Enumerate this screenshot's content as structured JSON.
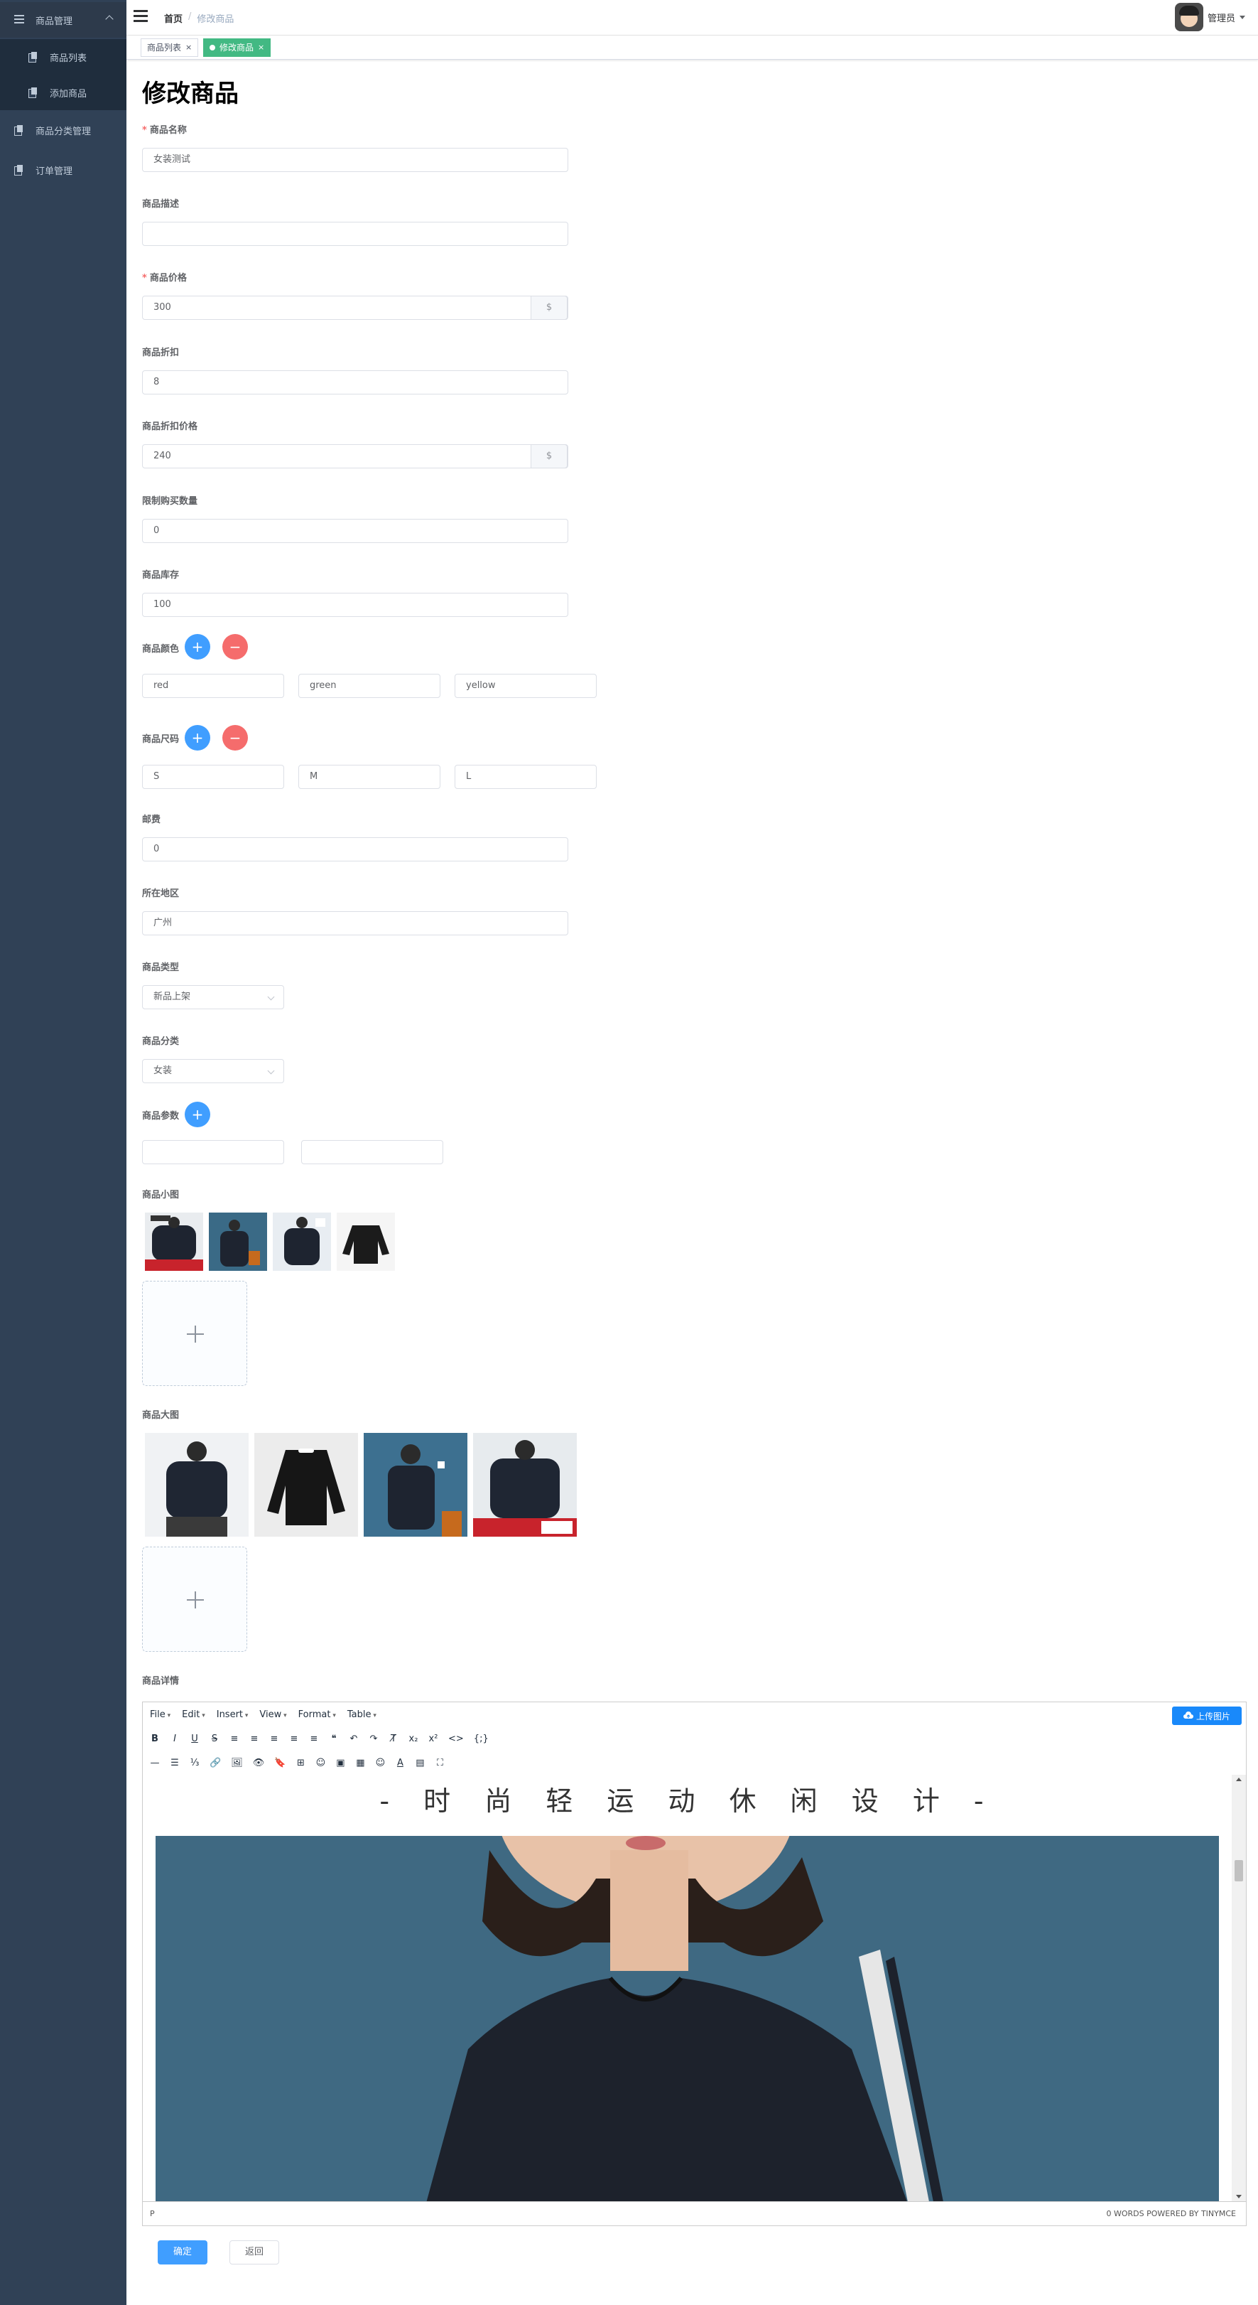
{
  "sidebar": {
    "menu_product_mgmt": "商品管理",
    "menu_product_list": "商品列表",
    "menu_add_product": "添加商品",
    "menu_category_mgmt": "商品分类管理",
    "menu_order_mgmt": "订单管理"
  },
  "navbar": {
    "breadcrumb_home": "首页",
    "breadcrumb_sep": "/",
    "breadcrumb_current": "修改商品",
    "username": "管理员"
  },
  "tags": {
    "list": "商品列表",
    "edit": "修改商品",
    "close": "×"
  },
  "page": {
    "title": "修改商品"
  },
  "form": {
    "name_label": "商品名称",
    "name_value": "女装测试",
    "desc_label": "商品描述",
    "desc_value": "",
    "price_label": "商品价格",
    "price_value": "300",
    "currency": "$",
    "discount_label": "商品折扣",
    "discount_value": "8",
    "discount_price_label": "商品折扣价格",
    "discount_price_value": "240",
    "limit_label": "限制购买数量",
    "limit_value": "0",
    "stock_label": "商品库存",
    "stock_value": "100",
    "color_label": "商品颜色",
    "colors": [
      "red",
      "green",
      "yellow"
    ],
    "size_label": "商品尺码",
    "sizes": [
      "S",
      "M",
      "L"
    ],
    "shipping_label": "邮费",
    "shipping_value": "0",
    "region_label": "所在地区",
    "region_value": "广州",
    "type_label": "商品类型",
    "type_value": "新品上架",
    "category_label": "商品分类",
    "category_value": "女装",
    "params_label": "商品参数",
    "small_images_label": "商品小图",
    "large_images_label": "商品大图",
    "detail_label": "商品详情",
    "add_symbol": "+",
    "remove_symbol": "−"
  },
  "editor": {
    "menus": [
      "File",
      "Edit",
      "Insert",
      "View",
      "Format",
      "Table"
    ],
    "upload_button": "上传图片",
    "toolbar_row1": [
      "B",
      "I",
      "U",
      "S",
      "≡",
      "≡",
      "≡",
      "≡",
      "≡",
      "❝",
      "↶",
      "↷",
      "T̸",
      "x₂",
      "x²",
      "<>",
      "{;}"
    ],
    "toolbar_row2": [
      "—",
      "☰",
      "⅓",
      "🔗",
      "🖼",
      "👁",
      "🔖",
      "⊞",
      "☺",
      "▣",
      "▦",
      "☺",
      "A",
      "▤",
      "⛶"
    ],
    "content_heading": "- 时 尚 轻 运 动 休 闲 设 计 -",
    "status_path": "P",
    "status_wordcount": "0 WORDS POWERED BY TINYMCE"
  },
  "actions": {
    "confirm": "确定",
    "back": "返回"
  },
  "colors": {
    "sidebar_bg": "#304156",
    "primary": "#409eff",
    "danger": "#f56c6c",
    "tag_active": "#42b983"
  }
}
